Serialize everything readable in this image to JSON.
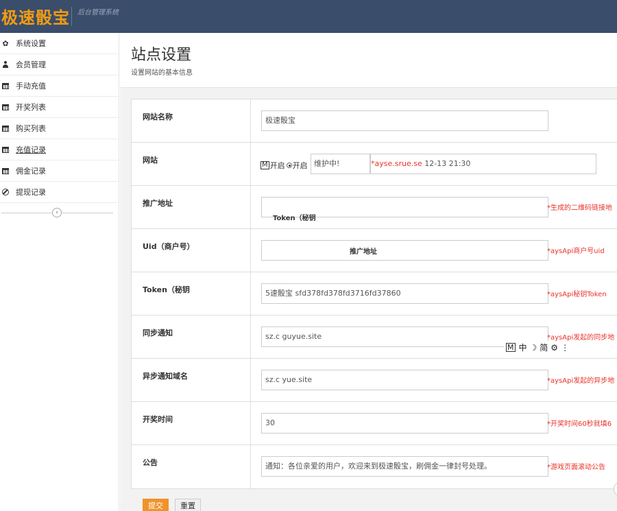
{
  "header": {
    "logo": "极速骰宝",
    "subtitle": "后台管理系统"
  },
  "sidebar": {
    "items": [
      {
        "label": "系统设置",
        "icon": "gear-icon"
      },
      {
        "label": "会员管理",
        "icon": "user-icon"
      },
      {
        "label": "手动充值",
        "icon": "calendar-icon"
      },
      {
        "label": "开奖列表",
        "icon": "calendar-icon"
      },
      {
        "label": "购买列表",
        "icon": "calendar-icon"
      },
      {
        "label": "充值记录",
        "icon": "calendar-icon"
      },
      {
        "label": "佣金记录",
        "icon": "calendar-icon"
      },
      {
        "label": "提现记录",
        "icon": "ban-icon"
      }
    ],
    "collapse_glyph": "‹"
  },
  "page": {
    "title": "站点设置",
    "description": "设置网站的基本信息"
  },
  "form": {
    "site_name": {
      "label": "网站名称",
      "value": "极速骰宝"
    },
    "site": {
      "label": "网站",
      "m_glyph": "M",
      "option_close": "开启",
      "option_open": "开启",
      "maintenance_value": "维护中!",
      "site_red": "*ayse.srue.se",
      "site_grey": " 12-13 21:30"
    },
    "promo_url": {
      "label": "推广地址",
      "value": "",
      "overlay": "Token（秘钥",
      "hint": "*生成的二维码链接地"
    },
    "uid": {
      "label": "Uid（商户号）",
      "value": "",
      "overlay": "推广地址",
      "hint": "*aysApi商户号uid"
    },
    "token": {
      "label": "Token（秘钥",
      "value": "5速骰宝 sfd378fd378fd3716fd37860",
      "hint": "*aysApi秘钥Token"
    },
    "sync_notify": {
      "label": "同步通知",
      "value": "sz.c guyue.site",
      "hint": "*aysApi发起的同步地"
    },
    "async_notify": {
      "label": "异步通知域名",
      "value": "sz.c yue.site",
      "hint": "*aysApi发起的异步地"
    },
    "draw_time": {
      "label": "开奖时间",
      "value": "30",
      "hint": "*开奖时间60秒就填6"
    },
    "notice": {
      "label": "公告",
      "value": "通知：各位亲爱的用户，欢迎来到极速骰宝，刷佣金一律封号处理。",
      "hint": "*游戏页面滚动公告"
    }
  },
  "ime_toolbar": {
    "m": "M",
    "zh": "中",
    "moon": "☽",
    "simplified": "简",
    "gear": "⚙",
    "more": "⋮"
  },
  "buttons": {
    "submit": "提交",
    "reset": "重置"
  },
  "colors": {
    "header_bg": "#3a4d6b",
    "logo": "#f39c12",
    "hint_red": "#e8322b",
    "submit": "#f0932b"
  }
}
